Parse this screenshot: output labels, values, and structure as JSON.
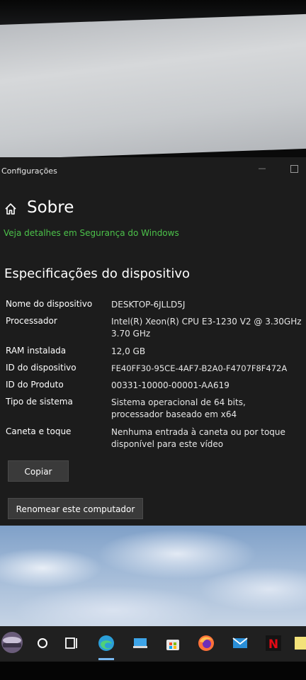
{
  "window": {
    "title": "Configurações",
    "minimize_glyph": "—"
  },
  "header": {
    "icon": "home-icon",
    "title": "Sobre"
  },
  "security_link": "Veja detalhes em Segurança do Windows",
  "section_title": "Especificações do dispositivo",
  "specs": [
    {
      "label": "Nome do dispositivo",
      "value": "DESKTOP-6JLLD5J"
    },
    {
      "label": "Processador",
      "value": "Intel(R) Xeon(R) CPU E3-1230 V2 @ 3.30GHz 3.70 GHz"
    },
    {
      "label": "RAM instalada",
      "value": "12,0 GB"
    },
    {
      "label": "ID do dispositivo",
      "value": "FE40FF30-95CE-4AF7-B2A0-F4707F8F472A"
    },
    {
      "label": "ID do Produto",
      "value": "00331-10000-00001-AA619"
    },
    {
      "label": "Tipo de sistema",
      "value": "Sistema operacional de 64 bits, processador baseado em x64"
    },
    {
      "label": "Caneta e toque",
      "value": "Nenhuma entrada à caneta ou por toque disponível para este vídeo"
    }
  ],
  "buttons": {
    "copy": "Copiar",
    "rename": "Renomear este computador"
  },
  "taskbar": {
    "items": [
      "start-icon",
      "cortana-icon",
      "task-view-icon",
      "edge-icon",
      "explorer-icon",
      "store-icon",
      "firefox-icon",
      "mail-icon",
      "netflix-icon",
      "notes-icon"
    ],
    "netflix_glyph": "N"
  },
  "colors": {
    "window_bg": "#1c1c1c",
    "link_green": "#4cc24a",
    "button_bg": "#3a3a3a",
    "taskbar_bg": "#202020"
  }
}
